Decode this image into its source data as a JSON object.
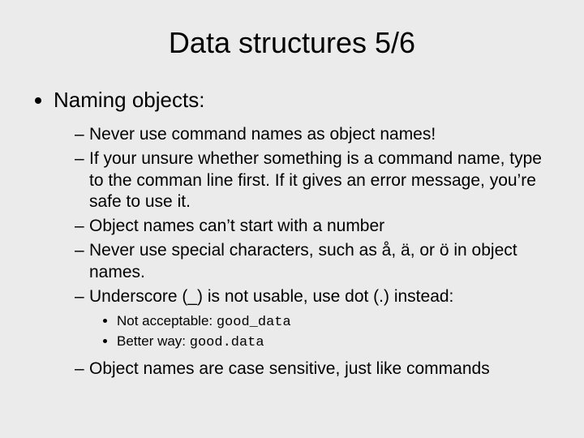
{
  "title": "Data structures 5/6",
  "top_bullet": "Naming objects:",
  "dash": [
    "Never use command names as object names!",
    "If your unsure whether something is a command name, type to the comman line first. If it gives an error message, you’re safe to use it.",
    "Object names can’t start with a number",
    "Never use special characters, such as å, ä, or ö in object names.",
    "Underscore (_) is not usable, use dot (.) instead:"
  ],
  "subdot": {
    "a_label": "Not acceptable: ",
    "a_code": "good_data",
    "b_label": "Better way: ",
    "b_code": "good.data"
  },
  "dash_last": "Object names are case sensitive, just like commands"
}
